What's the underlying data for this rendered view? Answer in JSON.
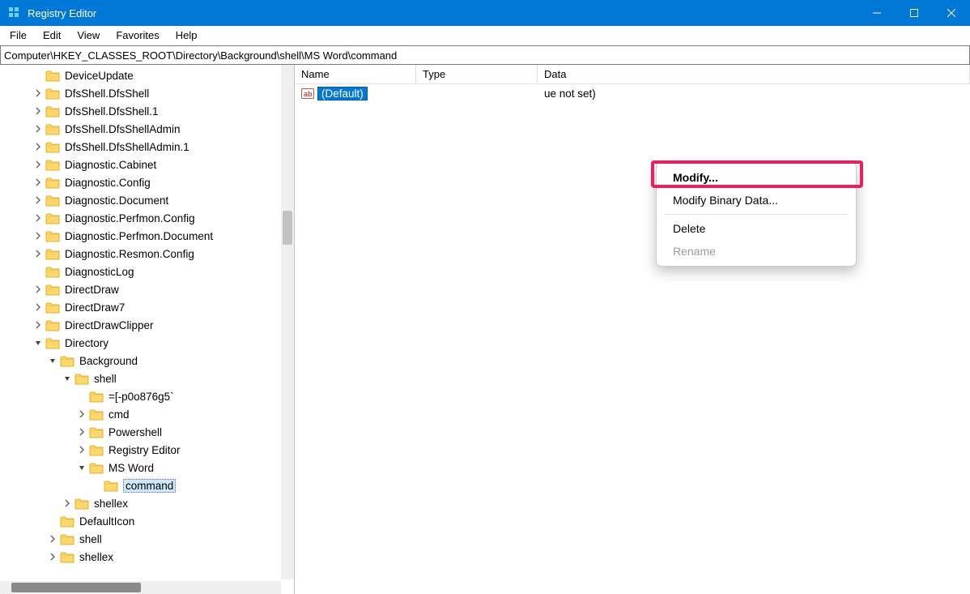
{
  "window": {
    "title": "Registry Editor"
  },
  "menu": {
    "file": "File",
    "edit": "Edit",
    "view": "View",
    "favorites": "Favorites",
    "help": "Help"
  },
  "address": "Computer\\HKEY_CLASSES_ROOT\\Directory\\Background\\shell\\MS Word\\command",
  "tree": [
    {
      "depth": 2,
      "expander": "none",
      "label": "DeviceUpdate"
    },
    {
      "depth": 2,
      "expander": "closed",
      "label": "DfsShell.DfsShell"
    },
    {
      "depth": 2,
      "expander": "closed",
      "label": "DfsShell.DfsShell.1"
    },
    {
      "depth": 2,
      "expander": "closed",
      "label": "DfsShell.DfsShellAdmin"
    },
    {
      "depth": 2,
      "expander": "closed",
      "label": "DfsShell.DfsShellAdmin.1"
    },
    {
      "depth": 2,
      "expander": "closed",
      "label": "Diagnostic.Cabinet"
    },
    {
      "depth": 2,
      "expander": "closed",
      "label": "Diagnostic.Config"
    },
    {
      "depth": 2,
      "expander": "closed",
      "label": "Diagnostic.Document"
    },
    {
      "depth": 2,
      "expander": "closed",
      "label": "Diagnostic.Perfmon.Config"
    },
    {
      "depth": 2,
      "expander": "closed",
      "label": "Diagnostic.Perfmon.Document"
    },
    {
      "depth": 2,
      "expander": "closed",
      "label": "Diagnostic.Resmon.Config"
    },
    {
      "depth": 2,
      "expander": "none",
      "label": "DiagnosticLog"
    },
    {
      "depth": 2,
      "expander": "closed",
      "label": "DirectDraw"
    },
    {
      "depth": 2,
      "expander": "closed",
      "label": "DirectDraw7"
    },
    {
      "depth": 2,
      "expander": "closed",
      "label": "DirectDrawClipper"
    },
    {
      "depth": 2,
      "expander": "open",
      "label": "Directory"
    },
    {
      "depth": 3,
      "expander": "open",
      "label": "Background"
    },
    {
      "depth": 4,
      "expander": "open",
      "label": "shell"
    },
    {
      "depth": 5,
      "expander": "none",
      "label": "=[-p0o876g5`"
    },
    {
      "depth": 5,
      "expander": "closed",
      "label": "cmd"
    },
    {
      "depth": 5,
      "expander": "closed",
      "label": "Powershell"
    },
    {
      "depth": 5,
      "expander": "closed",
      "label": "Registry Editor"
    },
    {
      "depth": 5,
      "expander": "open",
      "label": "MS Word"
    },
    {
      "depth": 6,
      "expander": "none",
      "label": "command",
      "selected": true
    },
    {
      "depth": 4,
      "expander": "closed",
      "label": "shellex"
    },
    {
      "depth": 3,
      "expander": "none",
      "label": "DefaultIcon"
    },
    {
      "depth": 3,
      "expander": "closed",
      "label": "shell"
    },
    {
      "depth": 3,
      "expander": "closed",
      "label": "shellex"
    }
  ],
  "list": {
    "columns": {
      "name": "Name",
      "type": "Type",
      "data": "Data"
    },
    "rows": [
      {
        "name": "(Default)",
        "type": "",
        "data": "ue not set)"
      }
    ]
  },
  "context_menu": {
    "modify": "Modify...",
    "modify_binary": "Modify Binary Data...",
    "delete": "Delete",
    "rename": "Rename"
  }
}
